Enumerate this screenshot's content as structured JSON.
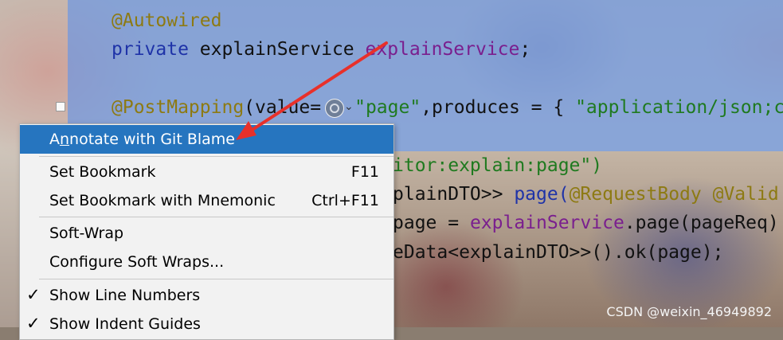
{
  "editor": {
    "lines": {
      "annotation1": "@Autowired",
      "field_kw": "private",
      "field_type": " explainService ",
      "field_name": "explainService",
      "field_end": ";",
      "mapping_ann": "@PostMapping",
      "mapping_args": "(value=",
      "mapping_str": "\"page\"",
      "mapping_produces": ",produces = { ",
      "mapping_str2": "\"application/json;c",
      "line5": "itor:explain:page\")",
      "line6_a": "plainDTO>> ",
      "line6_b": "page(",
      "line6_c": "@RequestBody @Valid",
      "line7_a": "page = ",
      "line7_b": "explainService",
      "line7_c": ".page(pageReq)",
      "line8": "eData<explainDTO>>().ok(page);"
    }
  },
  "context_menu": {
    "items": [
      {
        "label_pre": "A",
        "label_mnemonic": "n",
        "label_post": "notate with Git Blame",
        "shortcut": ""
      },
      {
        "label": "Set Bookmark",
        "shortcut": "F11"
      },
      {
        "label": "Set Bookmark with Mnemonic",
        "shortcut": "Ctrl+F11"
      },
      {
        "label": "Soft-Wrap",
        "shortcut": ""
      },
      {
        "label": "Configure Soft Wraps...",
        "shortcut": ""
      },
      {
        "label": "Show Line Numbers",
        "checked": true
      },
      {
        "label": "Show Indent Guides",
        "checked": true
      }
    ],
    "check_glyph": "✓"
  },
  "watermark": "CSDN @weixin_46949892",
  "colors": {
    "selection": "#2675bf",
    "arrow": "#e8302a"
  }
}
